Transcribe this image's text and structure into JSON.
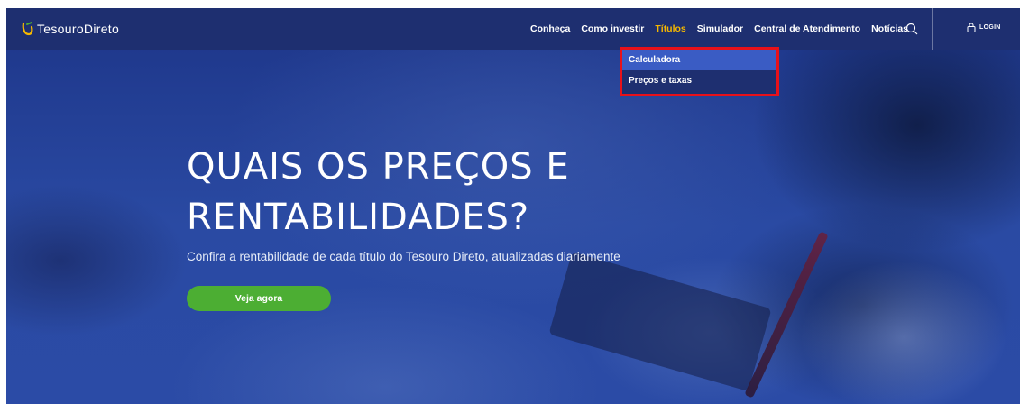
{
  "brand": {
    "logo_text": "TesouroDireto"
  },
  "nav": {
    "items": [
      {
        "label": "Conheça",
        "active": false
      },
      {
        "label": "Como investir",
        "active": false
      },
      {
        "label": "Títulos",
        "active": true
      },
      {
        "label": "Simulador",
        "active": false
      },
      {
        "label": "Central de Atendimento",
        "active": false
      },
      {
        "label": "Notícias",
        "active": false
      }
    ],
    "login_label": "LOGIN"
  },
  "dropdown": {
    "items": [
      {
        "label": "Calculadora",
        "hover": true
      },
      {
        "label": "Preços e taxas",
        "hover": false
      }
    ]
  },
  "hero": {
    "title_line1": "QUAIS OS PREÇOS E",
    "title_line2": "RENTABILIDADES?",
    "subtitle": "Confira a rentabilidade de cada título do Tesouro Direto, atualizadas diariamente",
    "cta_label": "Veja agora"
  },
  "colors": {
    "header_bg": "#1e2f70",
    "active_nav": "#f5b700",
    "cta": "#4cae33",
    "highlight_border": "#e8111a"
  }
}
